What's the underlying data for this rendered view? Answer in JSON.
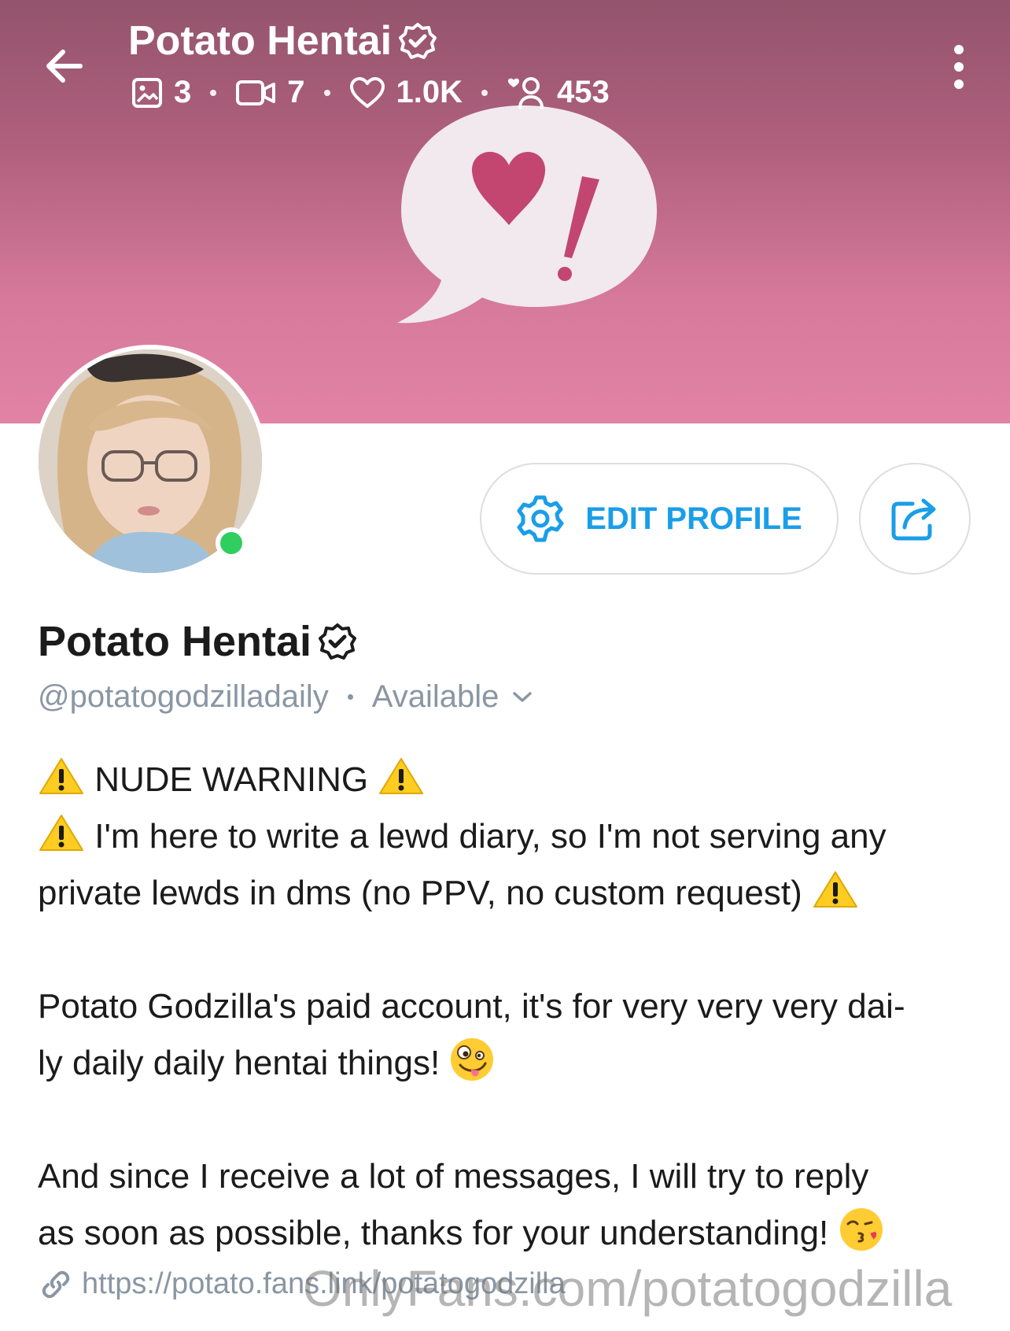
{
  "header": {
    "title": "Potato Hentai",
    "stats": {
      "photos": "3",
      "videos": "7",
      "likes": "1.0K",
      "fans": "453"
    }
  },
  "profile": {
    "name": "Potato Hentai",
    "handle": "@potatogodzilladaily",
    "status": "Available",
    "edit_label": "EDIT PROFILE",
    "online": true
  },
  "bio": {
    "warning_title": "NUDE WARNING",
    "line_notice_1": "I'm here to write a lewd diary, so I'm not serving any",
    "line_notice_2": "private lewds in dms (no PPV, no custom request)",
    "para2_line1": "Potato Godzilla's paid account, it's for very very very dai-",
    "para2_line2": "ly daily daily hentai things!",
    "para3_line1": "And since I receive a lot of messages, I will try to reply",
    "para3_line2": "as soon as possible, thanks for your understanding!"
  },
  "link": {
    "url": "https://potato.fans.link/potatogodzilla"
  },
  "watermark": "OnlyFans.com/potatogodzilla",
  "colors": {
    "accent": "#1a9ee8",
    "online": "#2fce5f",
    "cover": "#d6799a",
    "muted": "#8a96a3"
  },
  "icons": [
    "back-arrow-icon",
    "verified-icon",
    "image-icon",
    "video-icon",
    "heart-icon",
    "fans-icon",
    "more-vertical-icon",
    "gear-icon",
    "share-icon",
    "chevron-down-icon",
    "warning-icon",
    "link-icon"
  ]
}
